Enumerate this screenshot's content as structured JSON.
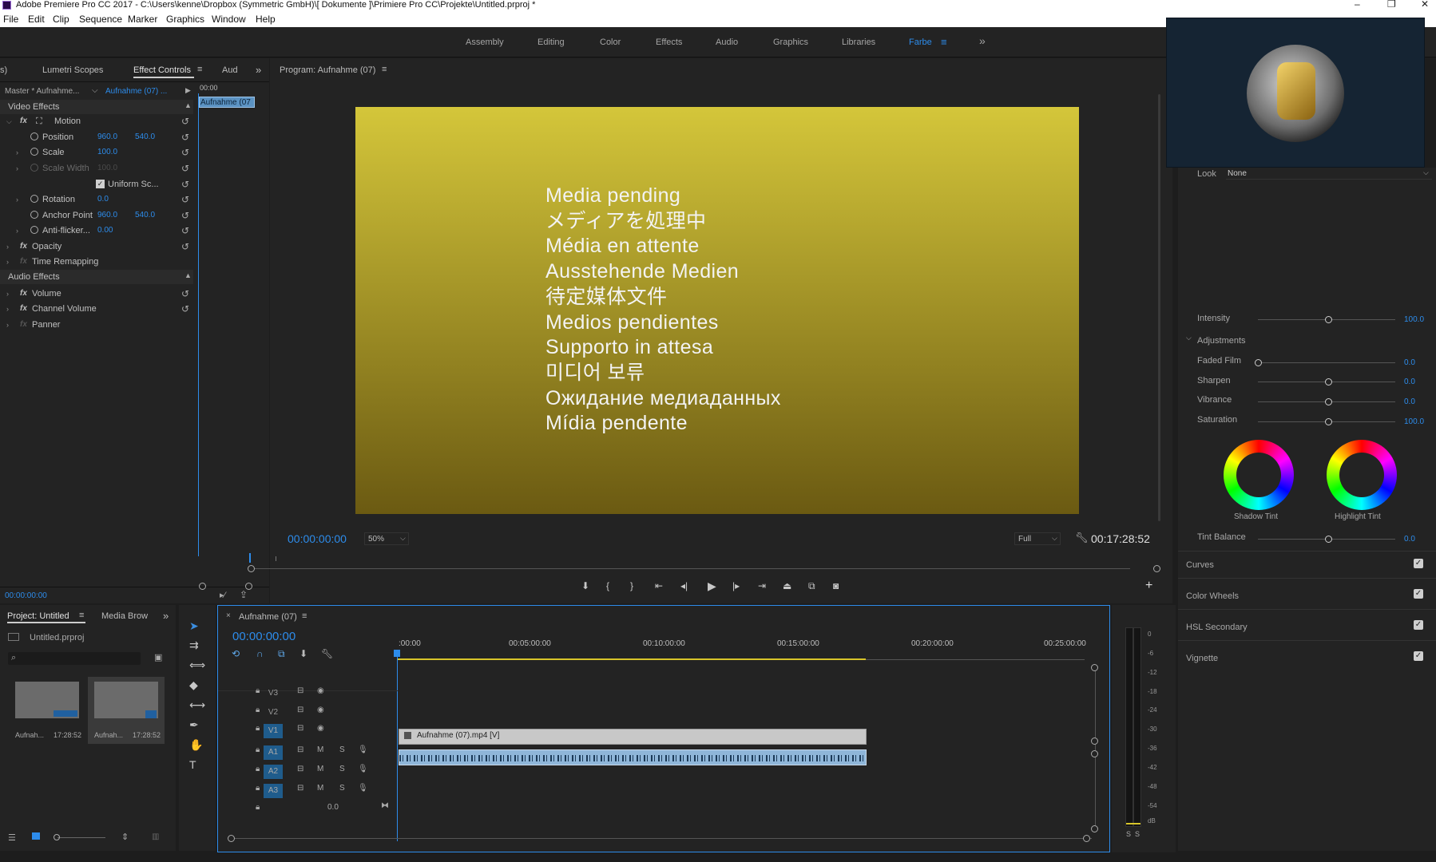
{
  "window": {
    "title": "Adobe Premiere Pro CC 2017 - C:\\Users\\kenne\\Dropbox (Symmetric GmbH)\\[ Dokumente ]\\Primiere Pro CC\\Projekte\\Untitled.prproj *",
    "minimize": "–",
    "restore": "❐",
    "close": "✕"
  },
  "menu": [
    "File",
    "Edit",
    "Clip",
    "Sequence",
    "Marker",
    "Graphics",
    "Window",
    "Help"
  ],
  "workspaces": {
    "tabs": [
      "Assembly",
      "Editing",
      "Color",
      "Effects",
      "Audio",
      "Graphics",
      "Libraries",
      "Farbe"
    ],
    "active": "Farbe",
    "more": "»"
  },
  "source_panel": {
    "tabs": [
      "s)",
      "Lumetri Scopes",
      "Effect Controls",
      "Aud"
    ],
    "master_label": "Master * Aufnahme...",
    "clip_label": "Aufnahme (07) ...",
    "timecode_mini": "00:00",
    "clip_bar": "Aufnahme (07",
    "video_effects": "Video Effects",
    "motion": "Motion",
    "position": {
      "label": "Position",
      "x": "960.0",
      "y": "540.0"
    },
    "scale": {
      "label": "Scale",
      "value": "100.0"
    },
    "scale_width": {
      "label": "Scale Width",
      "value": "100.0"
    },
    "uniform": "Uniform Sc...",
    "rotation": {
      "label": "Rotation",
      "value": "0.0"
    },
    "anchor": {
      "label": "Anchor Point",
      "x": "960.0",
      "y": "540.0"
    },
    "antiflicker": {
      "label": "Anti-flicker...",
      "value": "0.00"
    },
    "opacity": "Opacity",
    "time_remap": "Time Remapping",
    "audio_effects": "Audio Effects",
    "volume": "Volume",
    "channel_volume": "Channel Volume",
    "panner": "Panner",
    "timecode": "00:00:00:00"
  },
  "program": {
    "title": "Program: Aufnahme (07)",
    "media_lines": [
      "Media pending",
      "メディアを処理中",
      "Média en attente",
      "Ausstehende Medien",
      "待定媒体文件",
      "Medios pendientes",
      "Supporto in attesa",
      "미디어 보류",
      "Ожидание медиаданных",
      "Mídia pendente"
    ],
    "timecode": "00:00:00:00",
    "zoom": "50%",
    "quality": "Full",
    "duration": "00:17:28:52"
  },
  "project": {
    "tabs": [
      "Project: Untitled",
      "Media Brow"
    ],
    "file": "Untitled.prproj",
    "items": [
      {
        "name": "Aufnah...",
        "dur": "17:28:52"
      },
      {
        "name": "Aufnah...",
        "dur": "17:28:52"
      }
    ]
  },
  "timeline": {
    "tab": "Aufnahme (07)",
    "timecode": "00:00:00:00",
    "ruler": [
      ":00:00",
      "00:05:00:00",
      "00:10:00:00",
      "00:15:00:00",
      "00:20:00:00",
      "00:25:00:00"
    ],
    "video_tracks": [
      "V3",
      "V2",
      "V1"
    ],
    "audio_tracks": [
      "A1",
      "A2",
      "A3"
    ],
    "video_clip": "Aufnahme (07).mp4 [V]",
    "master_vol": "0.0",
    "mute": "M",
    "solo": "S"
  },
  "meter": {
    "scale": [
      "0",
      "-6",
      "-12",
      "-18",
      "-24",
      "-30",
      "-36",
      "-42",
      "-48",
      "-54",
      "dB"
    ],
    "solo": "S",
    "solo2": "S"
  },
  "lumetri": {
    "look_label": "Look",
    "look_value": "None",
    "intensity": {
      "label": "Intensity",
      "value": "100.0"
    },
    "adjustments": "Adjustments",
    "faded_film": {
      "label": "Faded Film",
      "value": "0.0"
    },
    "sharpen": {
      "label": "Sharpen",
      "value": "0.0"
    },
    "vibrance": {
      "label": "Vibrance",
      "value": "0.0"
    },
    "saturation": {
      "label": "Saturation",
      "value": "100.0"
    },
    "shadow_tint": "Shadow Tint",
    "highlight_tint": "Highlight Tint",
    "tint_balance": {
      "label": "Tint Balance",
      "value": "0.0"
    },
    "sections": [
      "Curves",
      "Color Wheels",
      "HSL Secondary",
      "Vignette"
    ]
  },
  "colors": {
    "accent": "#2d8ceb",
    "panel": "#232323",
    "frame_top": "#d4c63a",
    "frame_bottom": "#6b5a12"
  }
}
